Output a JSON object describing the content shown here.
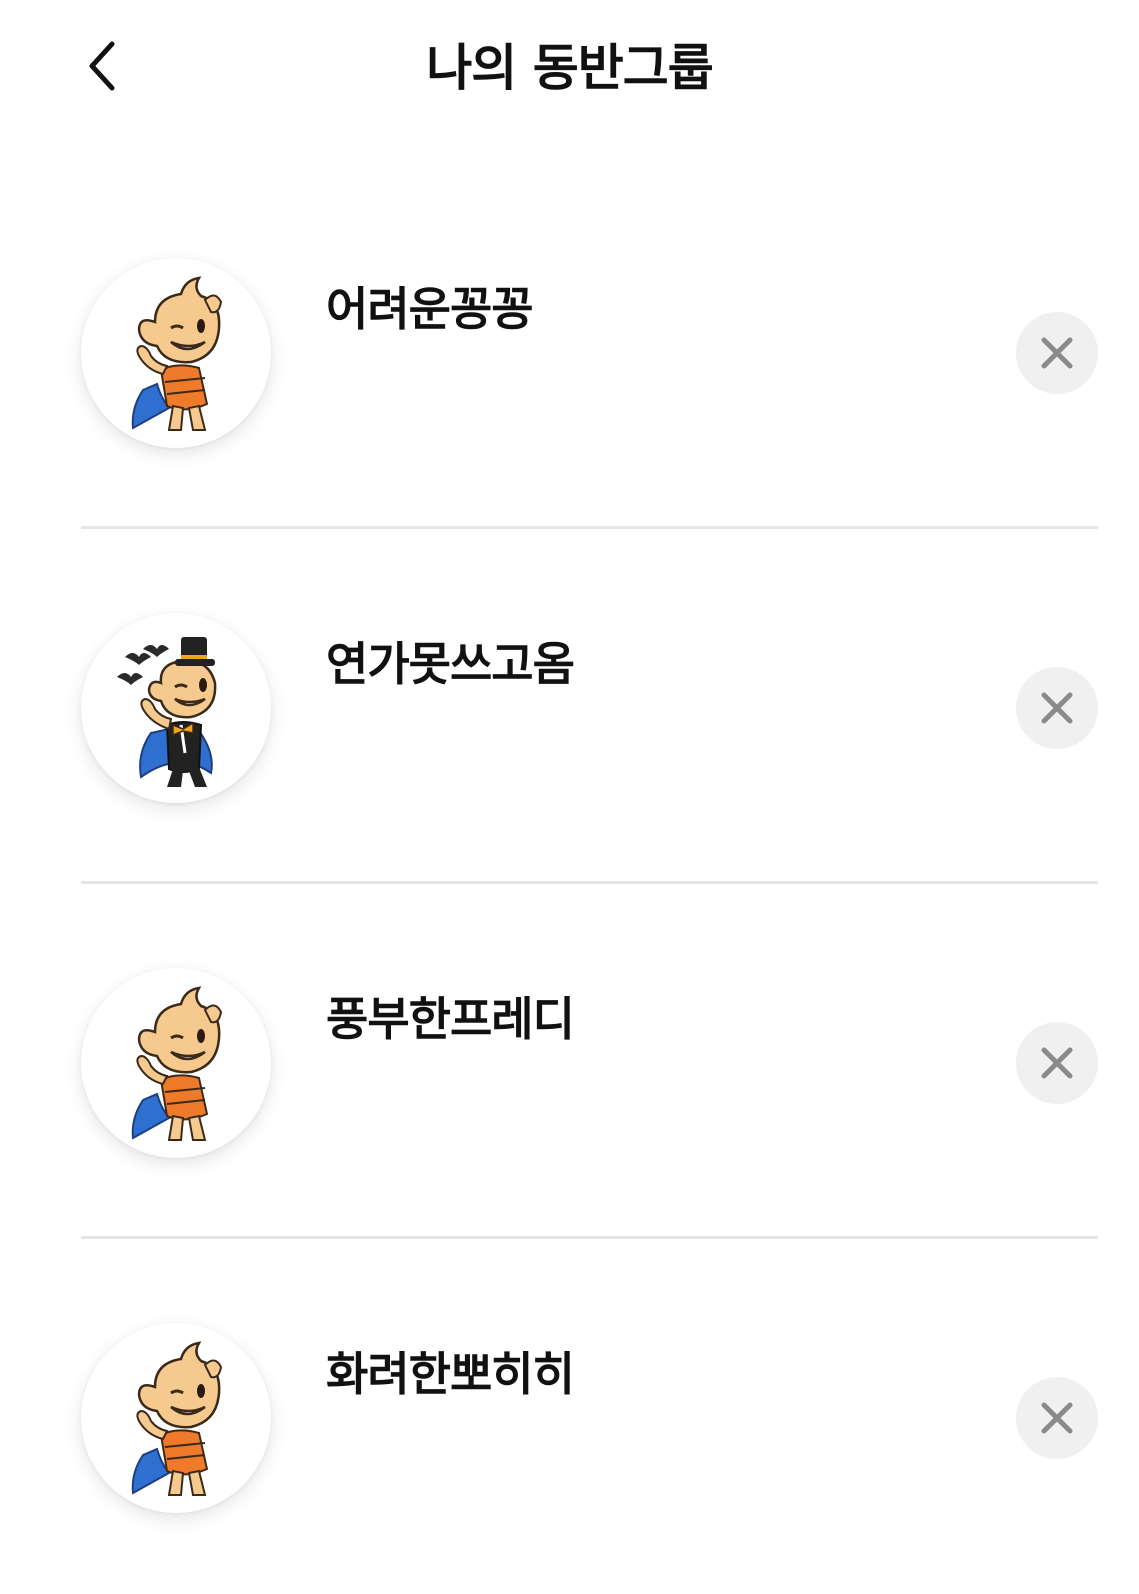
{
  "header": {
    "title": "나의 동반그룹",
    "back_icon": "chevron-left-icon"
  },
  "groups": [
    {
      "name": "어려운꽁꽁",
      "avatar": "mascot-winking-cape",
      "remove_icon": "close-icon"
    },
    {
      "name": "연가못쓰고옴",
      "avatar": "mascot-vampire-tophat-bats",
      "remove_icon": "close-icon"
    },
    {
      "name": "풍부한프레디",
      "avatar": "mascot-winking-cape",
      "remove_icon": "close-icon"
    },
    {
      "name": "화려한뽀히히",
      "avatar": "mascot-winking-cape",
      "remove_icon": "close-icon"
    }
  ],
  "colors": {
    "divider": "#e6e6e6",
    "remove_button_bg": "#f0f0f0",
    "remove_icon": "#8a8a8a",
    "mascot_skin": "#f6c98e",
    "mascot_shirt": "#ef7a2a",
    "mascot_cape": "#2f6fd0"
  }
}
